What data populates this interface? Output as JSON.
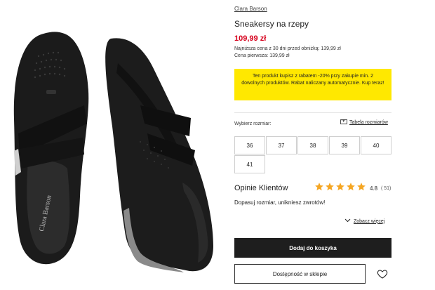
{
  "product": {
    "brand": "Clara Barson",
    "title": "Sneakersy na rzepy",
    "price": "109,99 zł",
    "lowest_price_note": "Najniższa cena z 30 dni przed obniżką: 139,99 zł",
    "first_price_note": "Cena pierwsza: 139,99 zł",
    "image_brand_mark": "Clara Barson"
  },
  "promo": {
    "text": "Ten produkt kupisz z rabatem -20% przy zakupie min. 2 dowolnych produktów. Rabat naliczany automatycznie. Kup teraz!",
    "bg_color": "#ffe800"
  },
  "sizes": {
    "label": "Wybierz rozmiar:",
    "table_link": "Tabela rozmiarów",
    "table_icon": "ruler-icon",
    "options": [
      "36",
      "37",
      "38",
      "39",
      "40",
      "41"
    ]
  },
  "reviews": {
    "title": "Opinie Klientów",
    "rating": "4.8",
    "count": "( 51)",
    "stars_filled": 4.8,
    "star_color": "#f5a623",
    "fit_note": "Dopasuj rozmiar, unikniesz zwrotów!",
    "see_more": "Zobacz więcej",
    "see_more_icon": "chevron-down-icon"
  },
  "actions": {
    "add_to_cart": "Dodaj do koszyka",
    "store_availability": "Dostępność w sklepie",
    "wishlist_icon": "heart-icon"
  },
  "colors": {
    "price": "#d6001c",
    "primary_button": "#1e1e1e"
  }
}
